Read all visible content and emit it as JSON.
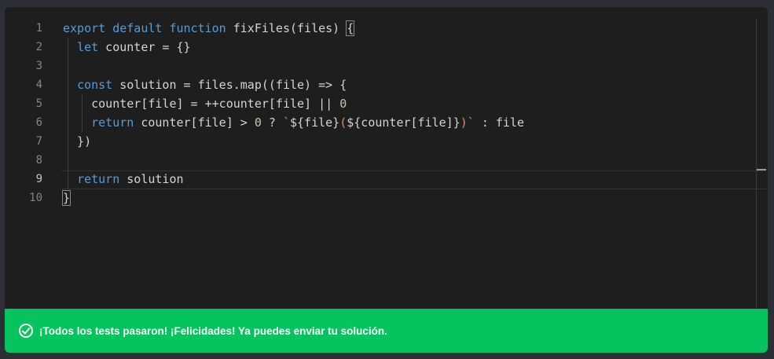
{
  "editor": {
    "line_numbers": [
      "1",
      "2",
      "3",
      "4",
      "5",
      "6",
      "7",
      "8",
      "9",
      "10"
    ],
    "lines": [
      [
        {
          "t": "export",
          "c": "kw"
        },
        {
          "t": " ",
          "c": "txt"
        },
        {
          "t": "default",
          "c": "kw"
        },
        {
          "t": " ",
          "c": "txt"
        },
        {
          "t": "function",
          "c": "kw"
        },
        {
          "t": " fixFiles(files) ",
          "c": "txt"
        },
        {
          "t": "{",
          "c": "brace"
        }
      ],
      [
        {
          "t": "  ",
          "c": "txt"
        },
        {
          "t": "let",
          "c": "kw"
        },
        {
          "t": " counter = {}",
          "c": "txt"
        }
      ],
      [],
      [
        {
          "t": "  ",
          "c": "txt"
        },
        {
          "t": "const",
          "c": "kw"
        },
        {
          "t": " solution = files.map((file) => {",
          "c": "txt"
        }
      ],
      [
        {
          "t": "    counter[file] = ++counter[file] || ",
          "c": "txt"
        },
        {
          "t": "0",
          "c": "num"
        }
      ],
      [
        {
          "t": "    ",
          "c": "txt"
        },
        {
          "t": "return",
          "c": "kw"
        },
        {
          "t": " counter[file] > ",
          "c": "txt"
        },
        {
          "t": "0",
          "c": "num"
        },
        {
          "t": " ? ",
          "c": "txt"
        },
        {
          "t": "`",
          "c": "str"
        },
        {
          "t": "${file}",
          "c": "txt"
        },
        {
          "t": "(",
          "c": "str"
        },
        {
          "t": "${counter[file]}",
          "c": "txt"
        },
        {
          "t": ")`",
          "c": "str"
        },
        {
          "t": " : file",
          "c": "txt"
        }
      ],
      [
        {
          "t": "  })",
          "c": "txt"
        }
      ],
      [],
      [
        {
          "t": "  ",
          "c": "txt"
        },
        {
          "t": "return",
          "c": "kw"
        },
        {
          "t": " solution",
          "c": "txt"
        }
      ],
      [
        {
          "t": "}",
          "c": "brace"
        }
      ]
    ],
    "active_line": 9
  },
  "toast": {
    "message": "¡Todos los tests pasaron! ¡Felicidades! Ya puedes enviar tu solución.",
    "icon": "check-circle-icon",
    "color": "#05c35d"
  }
}
